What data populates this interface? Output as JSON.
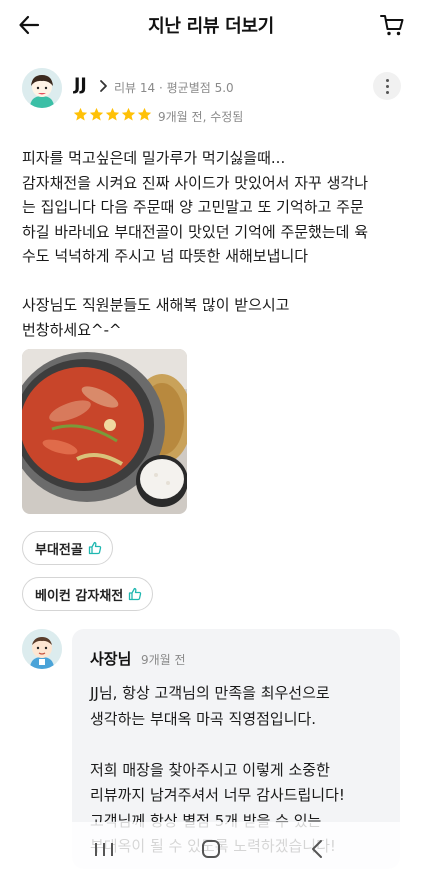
{
  "header": {
    "title": "지난 리뷰 더보기",
    "back_icon": "arrow-left-icon",
    "cart_icon": "cart-icon"
  },
  "review": {
    "reviewer_name": "JJ",
    "reviewer_meta": "리뷰 14 · 평균별점 5.0",
    "rating": 5,
    "rating_max": 5,
    "star_color": "#ffc107",
    "date": "9개월 전, 수정됨",
    "text_lines": [
      "피자를 먹고싶은데 밀가루가 먹기싫을때...",
      "감자채전을 시켜요 진짜 사이드가 맛있어서 자꾸 생각나",
      "는 집입니다 다음 주문때 양 고민말고 또 기억하고 주문",
      "하길 바라네요 부대전골이 맛있던 기억에 주문했는데 육",
      "수도 넉넉하게 주시고 넘 따뜻한 새해보냅니다",
      "",
      "사장님도 직원분들도 새해복 많이 받으시고",
      "번창하세요^-^"
    ],
    "menu_chips": [
      "부대전골",
      "베이컨 감자채전"
    ],
    "chip_icon_color": "#1fb7b0"
  },
  "owner_reply": {
    "name": "사장님",
    "date": "9개월 전",
    "text_lines": [
      "JJ님,  항상 고객님의 만족을 최우선으로",
      "생각하는 부대옥 마곡 직영점입니다.",
      "",
      "저희 매장을 찾아주시고 이렇게 소중한",
      "리뷰까지 남겨주셔서 너무 감사드립니다!",
      "고객님께 항상 별점 5개 받을 수 있는",
      "부대옥이 될 수 있도록 노력하겠습니다!"
    ]
  },
  "system_nav": {
    "recents_icon": "recents-icon",
    "home_icon": "home-icon",
    "back_icon": "back-chevron-icon"
  }
}
